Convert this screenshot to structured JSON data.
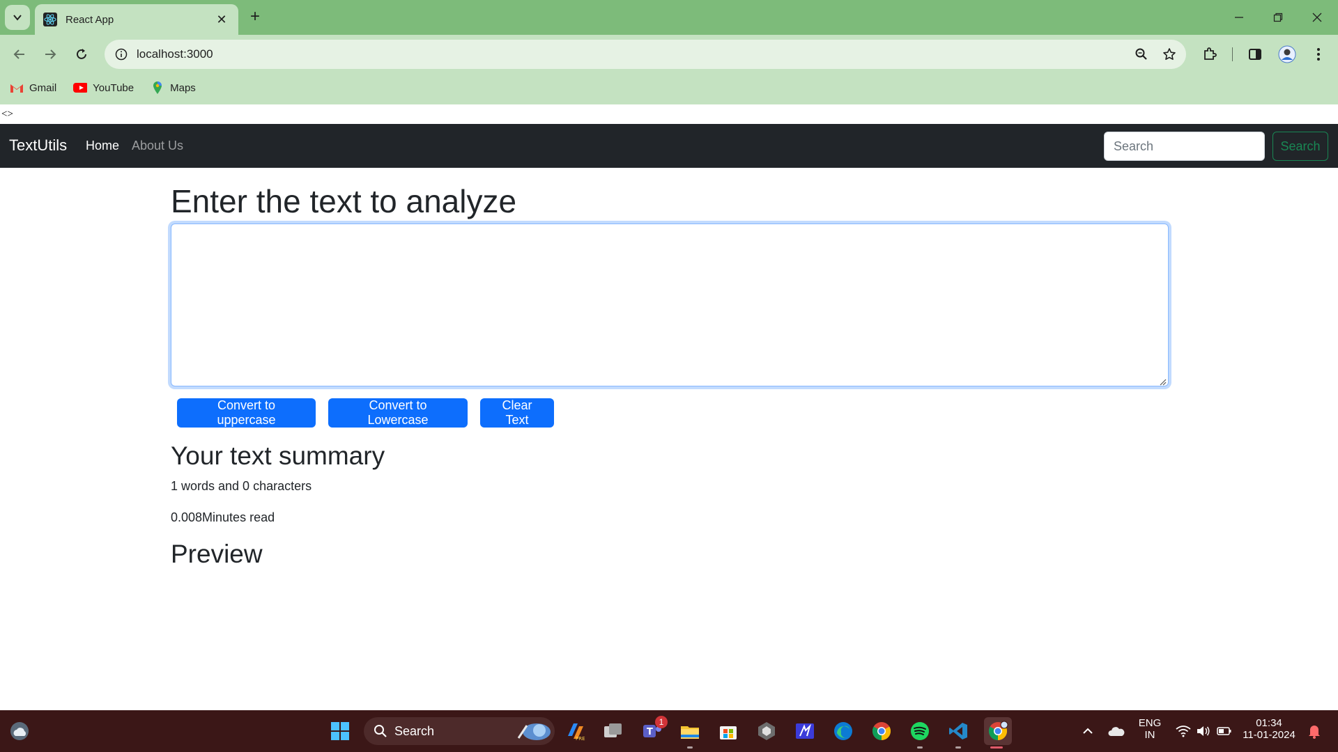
{
  "browser": {
    "tab": {
      "title": "React App"
    },
    "url": "localhost:3000",
    "bookmarks": [
      {
        "label": "Gmail"
      },
      {
        "label": "YouTube"
      },
      {
        "label": "Maps"
      }
    ]
  },
  "page": {
    "fragment_text": "<>",
    "navbar": {
      "brand": "TextUtils",
      "links": [
        {
          "label": "Home"
        },
        {
          "label": "About Us"
        }
      ],
      "search_placeholder": "Search",
      "search_button": "Search"
    },
    "heading": "Enter the text to analyze",
    "textarea_value": "",
    "buttons": {
      "uppercase": "Convert to uppercase",
      "lowercase": "Convert to Lowercase",
      "clear": "Clear Text"
    },
    "summary": {
      "heading": "Your text summary",
      "counts": "1 words and 0 characters",
      "read_time": "0.008Minutes read"
    },
    "preview_heading": "Preview"
  },
  "taskbar": {
    "search_label": "Search",
    "teams_badge": "1",
    "language_line1": "ENG",
    "language_line2": "IN",
    "time": "01:34",
    "date": "11-01-2024"
  },
  "colors": {
    "tabstrip": "#7dbb7a",
    "toolbar": "#c4e2c1",
    "navbar": "#212529",
    "primary_button": "#0d6efd",
    "success_outline": "#198754",
    "taskbar": "#3b1717"
  }
}
